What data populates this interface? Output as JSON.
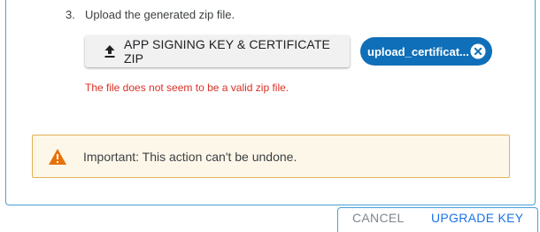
{
  "step": {
    "number": "3.",
    "text": "Upload the generated zip file."
  },
  "upload_button": {
    "label": "APP SIGNING KEY & CERTIFICATE ZIP",
    "icon": "upload-icon"
  },
  "file_chip": {
    "label": "upload_certificat...",
    "close_icon": "close-circle-icon",
    "color": "#0f6fb8"
  },
  "error": {
    "text": "The file does not seem to be a valid zip file.",
    "color": "#d93025"
  },
  "warning": {
    "icon": "warning-triangle-icon",
    "text": "Important: This action can't be undone.",
    "color": "#e8710a"
  },
  "actions": {
    "cancel_label": "CANCEL",
    "upgrade_label": "UPGRADE KEY"
  }
}
